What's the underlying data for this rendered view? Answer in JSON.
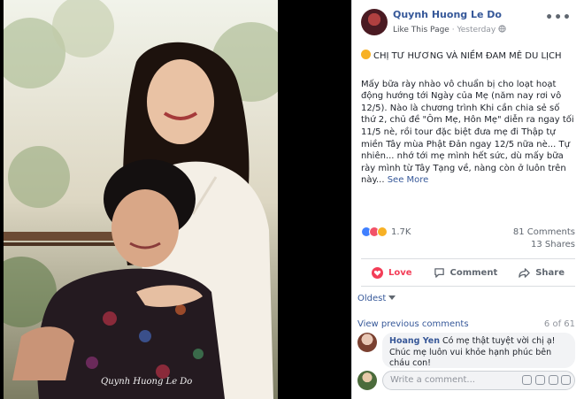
{
  "post": {
    "page_name": "Quynh Huong Le Do",
    "like_page": "Like This Page",
    "time": "Yesterday",
    "title": "CHỊ TƯ HƯƠNG VÀ NIỀM ĐAM MÊ DU LỊCH",
    "body": "Mấy bữa rày nhào vô chuẩn bị cho loạt hoạt động hướng tới Ngày của Mẹ (năm nay rơi vô 12/5). Nào là chương trình Khi cần chia sẻ số thứ 2, chủ đề \"Ôm Mẹ, Hôn Mẹ\" diễn ra ngay tối 11/5 nè, rồi tour đặc biệt đưa mẹ đi Thập tự miền Tây mùa Phật Đản ngay 12/5 nữa nè... Tự nhiên... nhớ tới mẹ mình hết sức, dù mấy bữa rày mình từ Tây Tạng về, nàng còn ở luôn trên này...",
    "see_more": "See More",
    "photo_signature": "Quynh Huong Le Do"
  },
  "stats": {
    "reactions": "1.7K",
    "comments": "81 Comments",
    "shares": "13 Shares"
  },
  "actions": {
    "love": "Love",
    "comment": "Comment",
    "share": "Share"
  },
  "comments": {
    "sort": "Oldest",
    "view_previous": "View previous comments",
    "count": "6 of 61",
    "items": [
      {
        "author": "Hoang Yen",
        "text": "Có mẹ thật tuyệt vời chị ạ! Chúc mẹ luôn vui khỏe hạnh phúc bên cháu con!"
      }
    ],
    "write_placeholder": "Write a comment..."
  },
  "colors": {
    "link": "#365899",
    "love": "#f33e58",
    "like": "#4080ff",
    "meta": "#90949c"
  }
}
